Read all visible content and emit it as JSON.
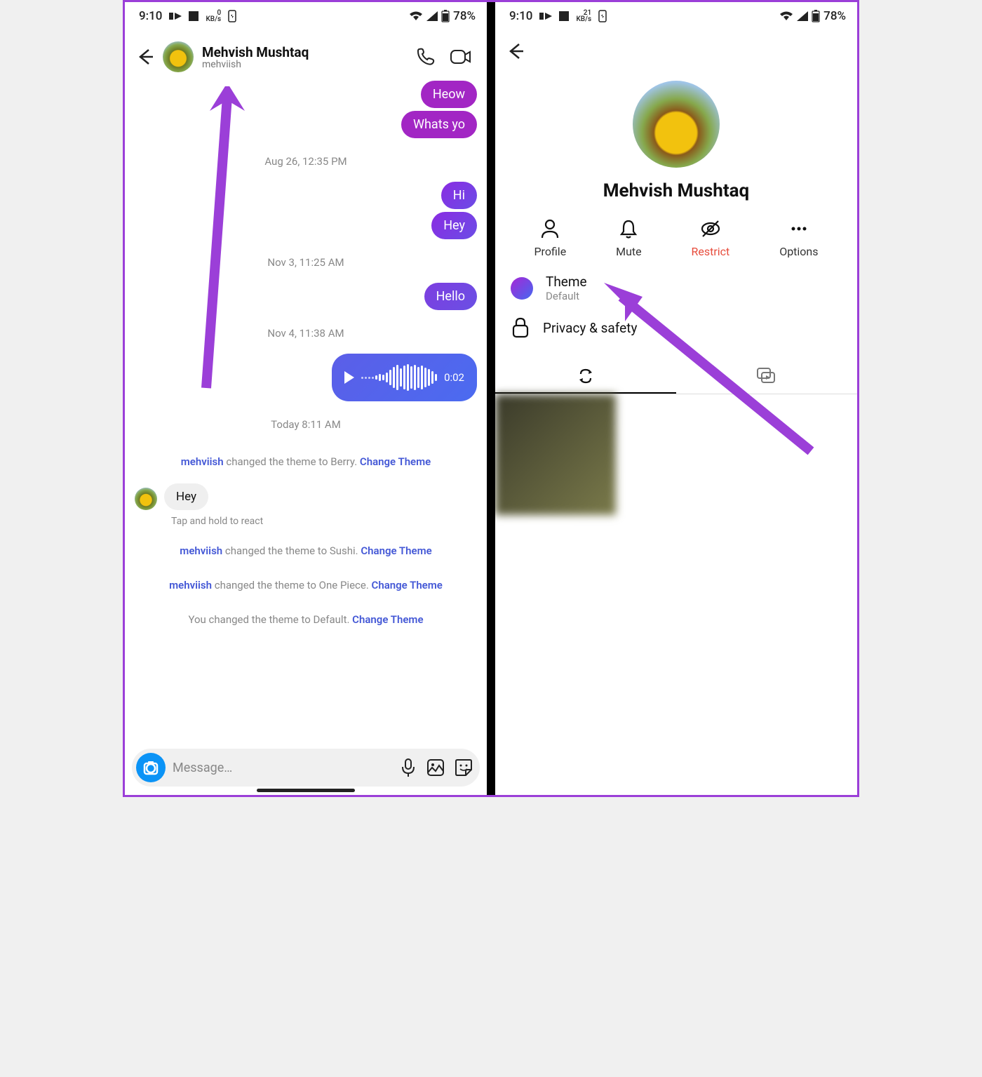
{
  "status": {
    "time": "9:10",
    "kb_left": "0",
    "kb_right": "21",
    "kb_unit": "KB/s",
    "battery": "78%"
  },
  "chat": {
    "name": "Mehvish Mushtaq",
    "handle": "mehviish",
    "messages": {
      "m1": "Heow",
      "m2": "Whats yo",
      "ts1": "Aug 26, 12:35 PM",
      "m3": "Hi",
      "m4": "Hey",
      "ts2": "Nov 3, 11:25 AM",
      "m5": "Hello",
      "ts3": "Nov 4, 11:38 AM",
      "voice_duration": "0:02",
      "ts4": "Today 8:11 AM",
      "incoming1": "Hey",
      "react_hint": "Tap and hold to react"
    },
    "system": {
      "user": "mehviish",
      "s1_mid": " changed the theme to Berry. ",
      "s2_mid": " changed the theme to Sushi. ",
      "s3_mid": " changed the theme to One Piece. ",
      "s4_full": "You changed the theme to Default. ",
      "link": "Change Theme"
    },
    "composer_placeholder": "Message…"
  },
  "profile": {
    "name": "Mehvish Mushtaq",
    "actions": {
      "profile": "Profile",
      "mute": "Mute",
      "restrict": "Restrict",
      "options": "Options"
    },
    "theme_label": "Theme",
    "theme_value": "Default",
    "privacy_label": "Privacy & safety"
  }
}
